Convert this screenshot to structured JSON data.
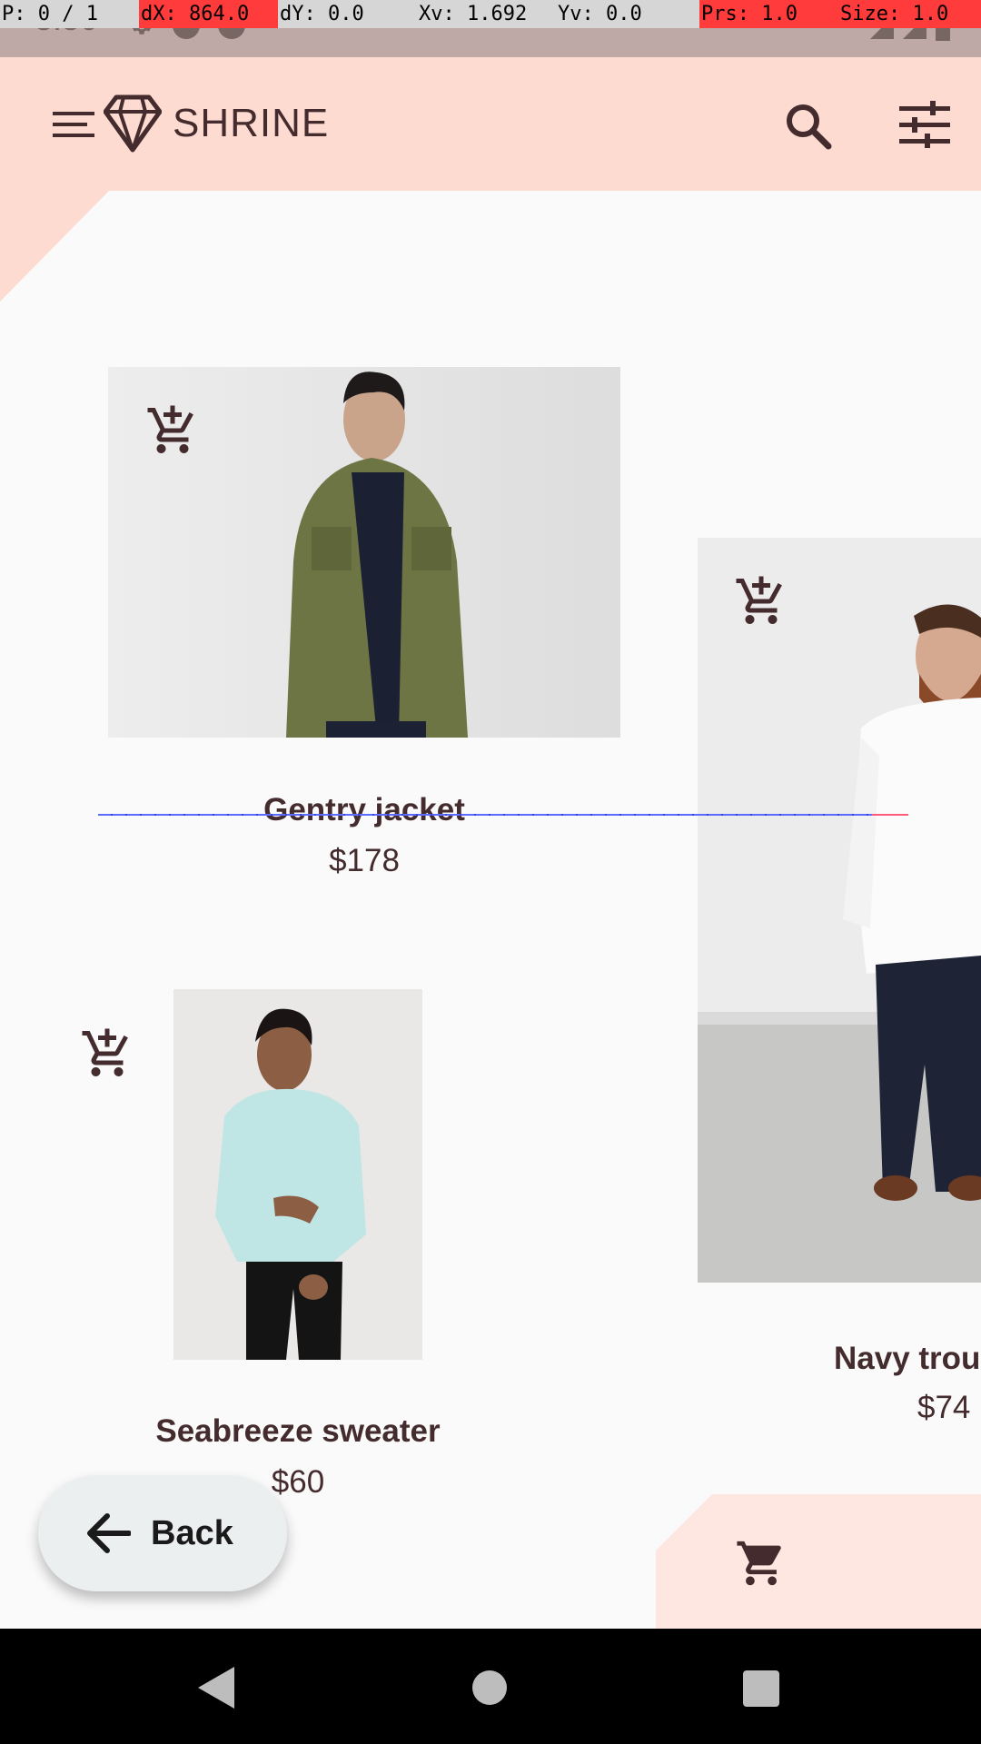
{
  "debug_overlay": {
    "pointer": "P: 0 / 1",
    "dx": "dX: 864.0",
    "dy": "dY: 0.0",
    "xv": "Xv: 1.692",
    "yv": "Yv: 0.0",
    "prs": "Prs: 1.0",
    "size": "Size: 1.0"
  },
  "status_bar": {
    "time": "3:50"
  },
  "app_bar": {
    "title": "SHRINE",
    "menu_icon": "menu-icon",
    "logo_icon": "diamond-icon",
    "search_icon": "search-icon",
    "filter_icon": "tune-icon"
  },
  "products": [
    {
      "name": "Gentry jacket",
      "price": "$178",
      "icon": "add-shopping-cart-icon"
    },
    {
      "name": "Navy trou",
      "price": "$74",
      "icon": "add-shopping-cart-icon"
    },
    {
      "name": "Seabreeze sweater",
      "price": "$60",
      "icon": "add-shopping-cart-icon"
    }
  ],
  "back_button": {
    "label": "Back",
    "icon": "arrow-back-icon"
  },
  "cart": {
    "icon": "shopping-cart-icon"
  },
  "colors": {
    "primary": "#FEDBD0",
    "on_primary": "#442B2D",
    "background": "#FAFAFA",
    "fab_background": "#ECEFF0"
  }
}
